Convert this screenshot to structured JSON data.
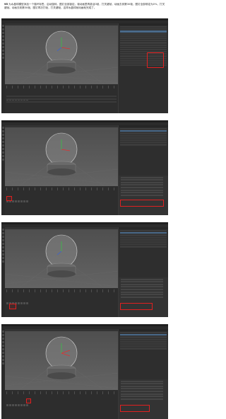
{
  "caption": {
    "number": "95",
    "text": "为水晶球模型添加一个循环标签，启动旋转，图钉全部锁定。帧动画里再激活0帧，打关键帧，动画去到第30帧，图钉全部绑定为0%，打关键帧。动画去到第30帧，图钉再次打帧，打关键帧，这样水晶球就动画就完成了。"
  },
  "screenshots": [
    {
      "id": "step-1"
    },
    {
      "id": "step-2"
    },
    {
      "id": "step-3"
    },
    {
      "id": "step-4"
    }
  ],
  "colors": {
    "highlight": "#e02020",
    "ui_dark": "#2e2e2e",
    "viewport": "#555555",
    "axis_y": "#2ecc40",
    "axis_x": "#e03030",
    "axis_z": "#3060e0"
  },
  "icons": {
    "sphere": "crystal-ball-icon",
    "record": "keyframe-record-icon"
  }
}
